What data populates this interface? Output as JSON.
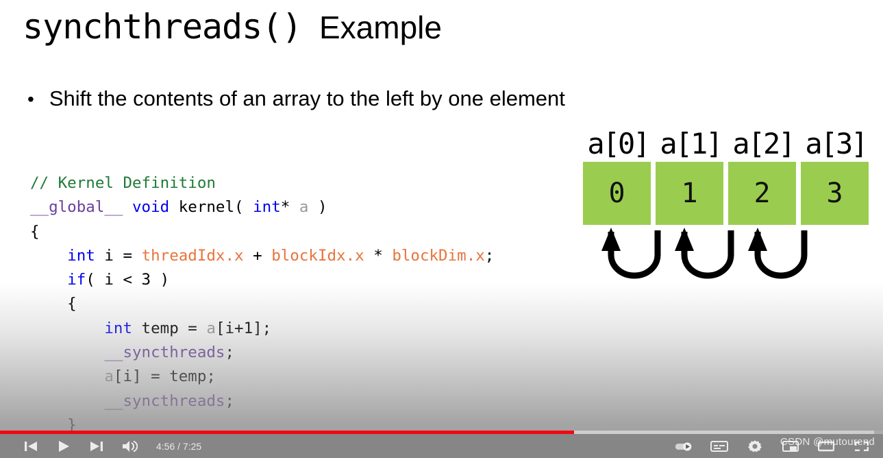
{
  "slide": {
    "title_main": "synchthreads()",
    "title_suffix": "  Example",
    "bullet_marker": "•",
    "bullet_text": "Shift the contents of an array to the left by one element",
    "code_lines": [
      [
        {
          "t": "// Kernel Definition",
          "c": "comment"
        }
      ],
      [
        {
          "t": "__global__",
          "c": "pre"
        },
        {
          "t": " ",
          "c": "plain"
        },
        {
          "t": "void",
          "c": "kw"
        },
        {
          "t": " kernel( ",
          "c": "plain"
        },
        {
          "t": "int",
          "c": "kw"
        },
        {
          "t": "* ",
          "c": "plain"
        },
        {
          "t": "a",
          "c": "var"
        },
        {
          "t": " )",
          "c": "plain"
        }
      ],
      [
        {
          "t": "{",
          "c": "plain"
        }
      ],
      [
        {
          "t": "    ",
          "c": "plain"
        },
        {
          "t": "int",
          "c": "kw"
        },
        {
          "t": " i = ",
          "c": "plain"
        },
        {
          "t": "threadIdx.x",
          "c": "builtin"
        },
        {
          "t": " + ",
          "c": "plain"
        },
        {
          "t": "blockIdx.x",
          "c": "builtin"
        },
        {
          "t": " * ",
          "c": "plain"
        },
        {
          "t": "blockDim.x",
          "c": "builtin"
        },
        {
          "t": ";",
          "c": "plain"
        }
      ],
      [
        {
          "t": "    ",
          "c": "plain"
        },
        {
          "t": "if",
          "c": "kw"
        },
        {
          "t": "( i < 3 )",
          "c": "plain"
        }
      ],
      [
        {
          "t": "    {",
          "c": "plain"
        }
      ],
      [
        {
          "t": "        ",
          "c": "plain"
        },
        {
          "t": "int",
          "c": "kw"
        },
        {
          "t": " temp = ",
          "c": "plain"
        },
        {
          "t": "a",
          "c": "var"
        },
        {
          "t": "[i+1];",
          "c": "plain"
        }
      ],
      [
        {
          "t": "        ",
          "c": "plain"
        },
        {
          "t": "__syncthreads",
          "c": "pre"
        },
        {
          "t": ";",
          "c": "plain"
        }
      ],
      [
        {
          "t": "        ",
          "c": "plain"
        },
        {
          "t": "a",
          "c": "var"
        },
        {
          "t": "[i] = temp;",
          "c": "plain"
        }
      ],
      [
        {
          "t": "        ",
          "c": "plain"
        },
        {
          "t": "__syncthreads",
          "c": "pre"
        },
        {
          "t": ";",
          "c": "plain"
        }
      ],
      [
        {
          "t": "    }",
          "c": "plain"
        }
      ],
      [
        {
          "t": "}",
          "c": "plain"
        }
      ]
    ],
    "array": {
      "labels": [
        "a[0]",
        "a[1]",
        "a[2]",
        "a[3]"
      ],
      "values": [
        "0",
        "1",
        "2",
        "3"
      ],
      "cell_color": "#9acd4f",
      "arrow_count": 3
    }
  },
  "player": {
    "time_current": "4:56",
    "time_total": "7:25",
    "time_display": "4:56 / 7:25",
    "progress_percent": 65,
    "buffered_percent": 99,
    "progress_color": "#f40612",
    "watermark": "CSDN @mutourend",
    "left_controls": [
      {
        "name": "previous-video-button",
        "icon": "skip-previous-icon"
      },
      {
        "name": "play-button",
        "icon": "play-icon"
      },
      {
        "name": "next-video-button",
        "icon": "skip-next-icon"
      },
      {
        "name": "volume-button",
        "icon": "volume-icon"
      }
    ],
    "right_controls": [
      {
        "name": "autoplay-toggle",
        "icon": "autoplay-icon"
      },
      {
        "name": "subtitles-button",
        "icon": "subtitles-icon"
      },
      {
        "name": "settings-button",
        "icon": "gear-icon"
      },
      {
        "name": "miniplayer-button",
        "icon": "miniplayer-icon"
      },
      {
        "name": "theater-mode-button",
        "icon": "theater-icon"
      },
      {
        "name": "fullscreen-button",
        "icon": "fullscreen-icon"
      }
    ]
  }
}
